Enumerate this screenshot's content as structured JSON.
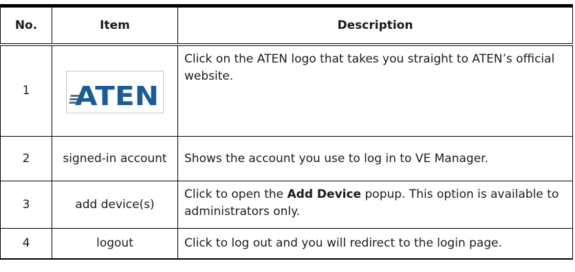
{
  "table": {
    "headers": [
      "No.",
      "Item",
      "Description"
    ],
    "rows": [
      {
        "no": "1",
        "item_logo_text": "ATEN",
        "description": "Click on the ATEN logo that takes you straight to ATEN’s official website."
      },
      {
        "no": "2",
        "item": "signed-in account",
        "description": "Shows the account you use to log in to VE Manager."
      },
      {
        "no": "3",
        "item": "add device(s)",
        "description_before": "Click to open the ",
        "description_bold": "Add Device",
        "description_after": " popup. This option is available to administrators only."
      },
      {
        "no": "4",
        "item": "logout",
        "description": "Click to log out and you will redirect to the login page."
      }
    ]
  },
  "colors": {
    "logo_blue": "#1d5b97",
    "logo_stripes": "#5a6f86"
  }
}
